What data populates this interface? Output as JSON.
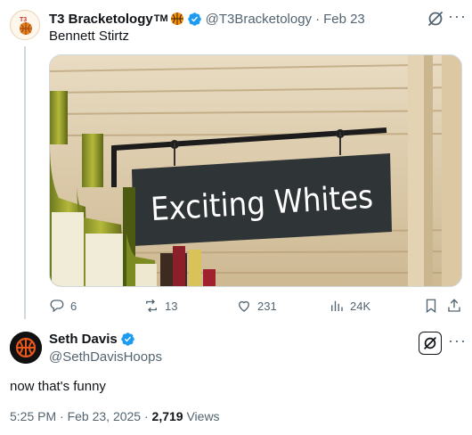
{
  "parent_post": {
    "author_name": "T3 Bracketology",
    "author_tm": "TM",
    "handle": "@T3Bracketology",
    "separator": "·",
    "date": "Feb 23",
    "text": "Bennett Stirtz",
    "media": {
      "sign_text": "Exciting Whites"
    },
    "stats": {
      "replies": "6",
      "reposts": "13",
      "likes": "231",
      "views": "24K"
    }
  },
  "reply_post": {
    "author_name": "Seth Davis",
    "handle": "@SethDavisHoops",
    "text": "now that's funny",
    "timestamp": "5:25 PM · Feb 23, 2025 · ",
    "views_count": "2,719",
    "views_label": " Views"
  },
  "colors": {
    "primary_text": "#0f1419",
    "secondary_text": "#536471",
    "verified_blue": "#1d9bf0",
    "border": "#cfd9de"
  },
  "icons": [
    "grok-icon",
    "more-icon",
    "reply-icon",
    "repost-icon",
    "like-icon",
    "views-icon",
    "bookmark-icon",
    "share-icon",
    "verified-badge-icon",
    "basketball-icon"
  ]
}
